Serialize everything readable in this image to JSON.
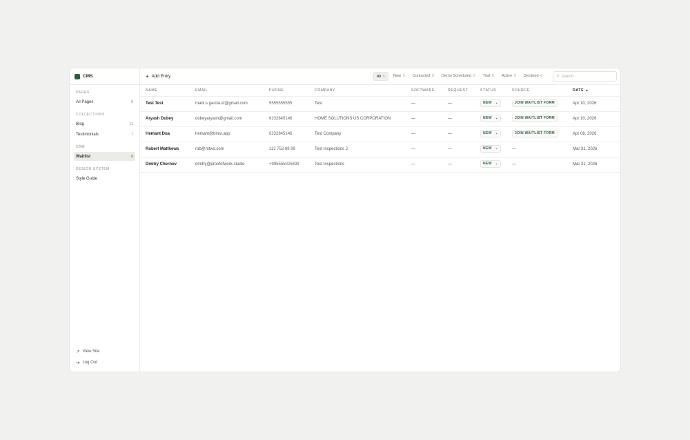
{
  "brand": {
    "name": "CMS"
  },
  "sidebar": {
    "pages_heading": "PAGES",
    "all_pages": {
      "label": "All Pages",
      "count": "5"
    },
    "collections_heading": "COLLECTIONS",
    "blog": {
      "label": "Blog",
      "count": "11"
    },
    "testimonials": {
      "label": "Testimonials",
      "count": "7"
    },
    "crm_heading": "CRM",
    "waitlist": {
      "label": "Waitlist",
      "count": "5"
    },
    "design_heading": "DESIGN SYSTEM",
    "style_guide": {
      "label": "Style Guide"
    },
    "view_site": "View Site",
    "log_out": "Log Out"
  },
  "toolbar": {
    "add_entry": "Add Entry",
    "filters": [
      {
        "label": "All",
        "count": "5"
      },
      {
        "label": "New",
        "count": "5"
      },
      {
        "label": "Contacted",
        "count": "0"
      },
      {
        "label": "Demo Scheduled",
        "count": "0"
      },
      {
        "label": "Trial",
        "count": "0"
      },
      {
        "label": "Active",
        "count": "0"
      },
      {
        "label": "Declined",
        "count": "0"
      }
    ],
    "search_placeholder": "Search..."
  },
  "table": {
    "headers": {
      "name": "NAME",
      "email": "EMAIL",
      "phone": "PHONE",
      "company": "COMPANY",
      "software": "SOFTWARE",
      "request": "REQUEST",
      "status": "STATUS",
      "source": "SOURCE",
      "date": "DATE",
      "sort_icon": "▲"
    },
    "rows": [
      {
        "name": "Test Test",
        "email": "mark.s.garcia.sf@gmail.com",
        "phone": "5555555555",
        "company": "Test",
        "software": "—",
        "request": "—",
        "status": "NEW",
        "source": "JOIN WAITLIST FORM",
        "date": "Apr 10, 2026"
      },
      {
        "name": "Aryash Dubey",
        "email": "dubeyaryash@gmail.com",
        "phone": "6232845146",
        "company": "HOME SOLUTIONS US CORPORATION",
        "software": "—",
        "request": "—",
        "status": "NEW",
        "source": "JOIN WAITLIST FORM",
        "date": "Apr 10, 2026"
      },
      {
        "name": "Hemant Dua",
        "email": "hemant@binsr.app",
        "phone": "6232845146",
        "company": "Test Company",
        "software": "—",
        "request": "—",
        "status": "NEW",
        "source": "JOIN WAITLIST FORM",
        "date": "Apr 08, 2026"
      },
      {
        "name": "Robert Matthews",
        "email": "rob@mtws.com",
        "phone": "112 753 88 99",
        "company": "Test Inspections 2",
        "software": "—",
        "request": "—",
        "status": "NEW",
        "source": "—",
        "date": "Mar 31, 2026"
      },
      {
        "name": "Dmitry Chernov",
        "email": "dmitry@proofofwork.studio",
        "phone": "+995555025899",
        "company": "Test Inspections",
        "software": "—",
        "request": "—",
        "status": "NEW",
        "source": "—",
        "date": "Mar 31, 2026"
      }
    ]
  }
}
